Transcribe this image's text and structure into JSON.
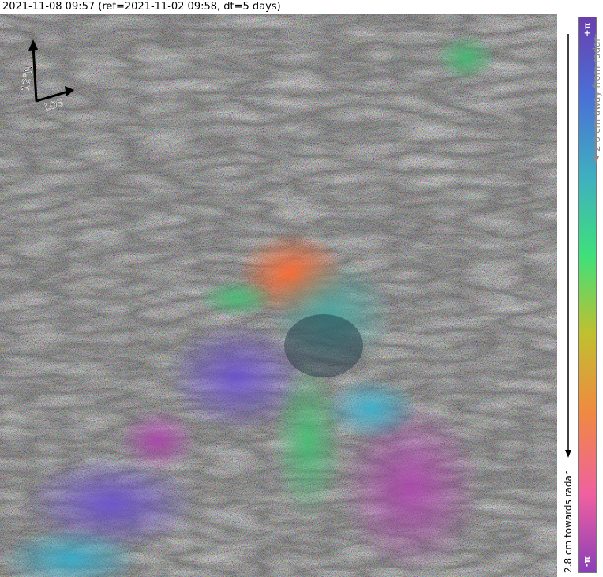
{
  "title": "2021-11-08 09:57 (ref=2021-11-02 09:58, dt=5 days)",
  "north_arrow": {
    "north_label": "12°N",
    "los_label": "LOS"
  },
  "colorbar": {
    "top_label": "+π",
    "bottom_label": "-π",
    "away_label": "2.8 cm away from radar",
    "towards_label": "2.8 cm towards radar",
    "gradient_stops": [
      "#6a3fae",
      "#4a6fd6",
      "#3fb0c0",
      "#3fe07a",
      "#c0c030",
      "#f08a40",
      "#f060a0",
      "#8a3fb8"
    ]
  }
}
